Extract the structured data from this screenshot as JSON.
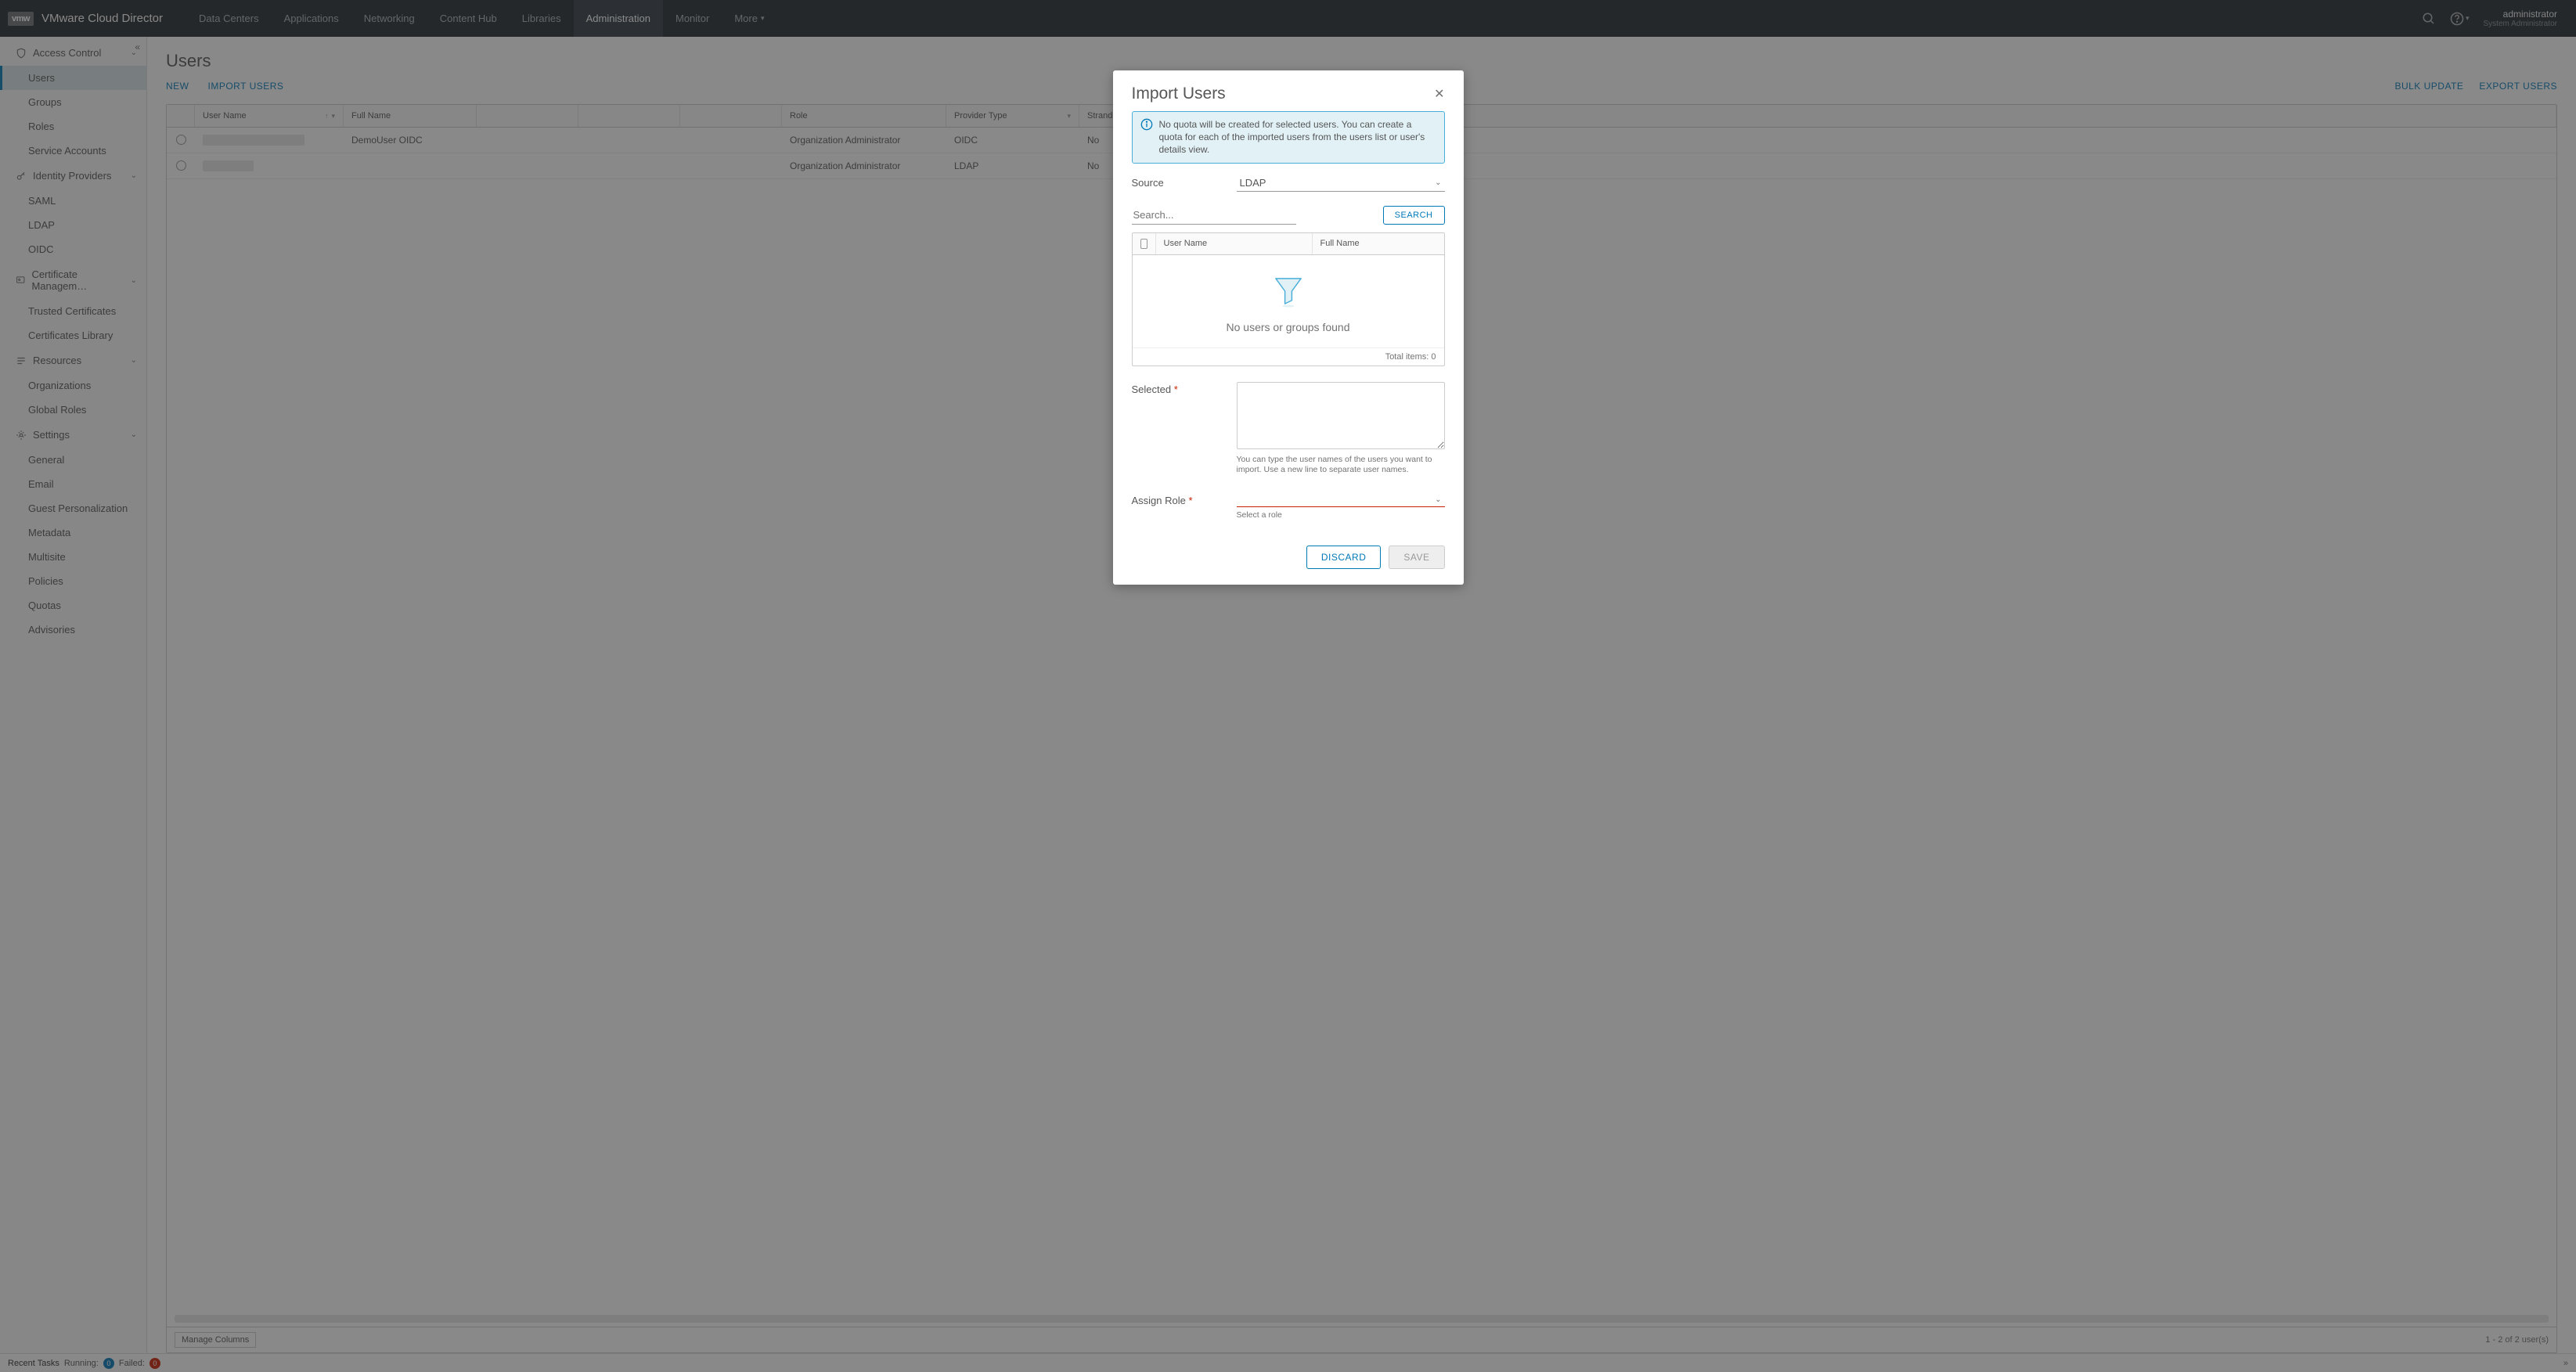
{
  "header": {
    "brand_badge": "vmw",
    "app_title": "VMware Cloud Director",
    "nav": [
      "Data Centers",
      "Applications",
      "Networking",
      "Content Hub",
      "Libraries",
      "Administration",
      "Monitor",
      "More"
    ],
    "nav_active_index": 5,
    "user": {
      "name": "administrator",
      "role": "System Administrator"
    }
  },
  "sidebar": {
    "groups": [
      {
        "label": "Access Control",
        "items": [
          "Users",
          "Groups",
          "Roles",
          "Service Accounts"
        ],
        "active_item_index": 0
      },
      {
        "label": "Identity Providers",
        "items": [
          "SAML",
          "LDAP",
          "OIDC"
        ]
      },
      {
        "label": "Certificate Managem…",
        "items": [
          "Trusted Certificates",
          "Certificates Library"
        ]
      },
      {
        "label": "Resources",
        "items": [
          "Organizations",
          "Global Roles"
        ]
      },
      {
        "label": "Settings",
        "items": [
          "General",
          "Email",
          "Guest Personalization",
          "Metadata",
          "Multisite",
          "Policies",
          "Quotas",
          "Advisories"
        ]
      }
    ]
  },
  "page": {
    "title": "Users",
    "actions": {
      "new": "NEW",
      "import": "IMPORT USERS",
      "bulk": "BULK UPDATE",
      "export": "EXPORT USERS"
    },
    "grid": {
      "columns": [
        "User Name",
        "Full Name",
        "",
        "",
        "",
        "Role",
        "Provider Type",
        "",
        "Stranded"
      ],
      "rows": [
        {
          "user": "",
          "full": "DemoUser OIDC",
          "role": "Organization Administrator",
          "provider": "OIDC",
          "stranded": "No"
        },
        {
          "user": "",
          "full": "",
          "role": "Organization Administrator",
          "provider": "LDAP",
          "stranded": "No"
        }
      ],
      "manage_columns": "Manage Columns",
      "page_info": "1 - 2 of 2 user(s)"
    }
  },
  "taskbar": {
    "label": "Recent Tasks",
    "running_label": "Running:",
    "running_count": "0",
    "failed_label": "Failed:",
    "failed_count": "0"
  },
  "modal": {
    "title": "Import Users",
    "info": "No quota will be created for selected users. You can create a quota for each of the imported users from the users list or user's details view.",
    "source_label": "Source",
    "source_value": "LDAP",
    "search_placeholder": "Search...",
    "search_button": "SEARCH",
    "picker": {
      "col_user": "User Name",
      "col_full": "Full Name",
      "empty": "No users or groups found",
      "total_label": "Total items: 0"
    },
    "selected_label": "Selected",
    "selected_hint": "You can type the user names of the users you want to import. Use a new line to separate user names.",
    "assign_label": "Assign Role",
    "assign_hint": "Select a role",
    "discard": "DISCARD",
    "save": "SAVE"
  }
}
